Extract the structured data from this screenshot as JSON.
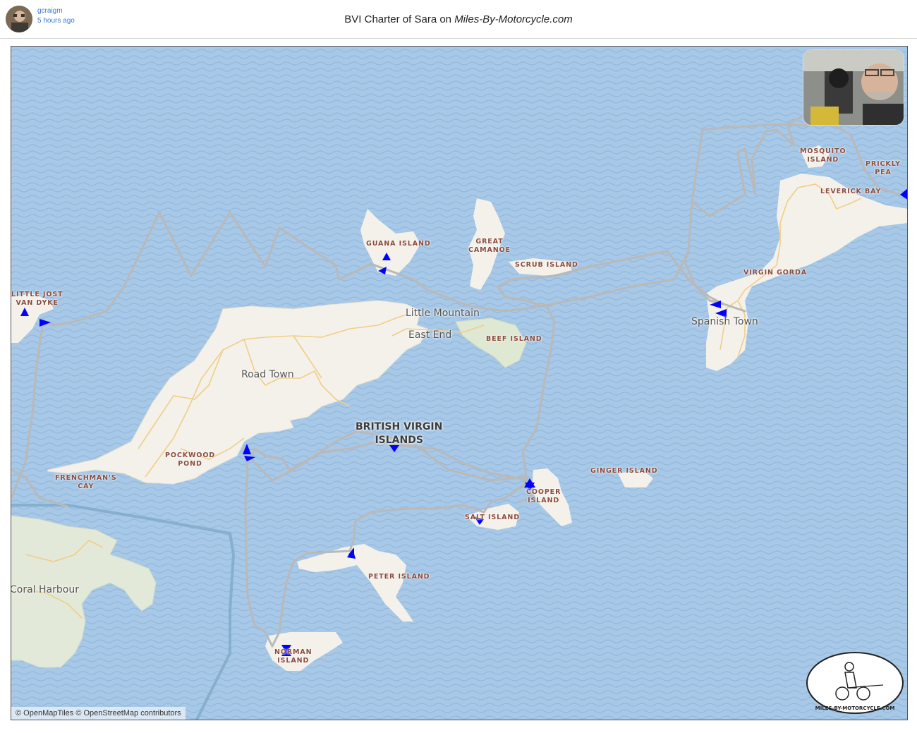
{
  "header": {
    "user": "gcraigm",
    "time_ago": "5 hours ago",
    "title_prefix": "BVI Charter of Sara on ",
    "title_site": "Miles-By-Motorcycle.com"
  },
  "map": {
    "water_color": "#a7c8e6",
    "land_color": "#f4f1ea",
    "road_color": "#f5d79e",
    "track_color": "#b9b9b9",
    "marker_color": "#0000ff",
    "island_labels": [
      {
        "id": "little-jost-van-dyke",
        "text": "LITTLE JOST\nVAN DYKE"
      },
      {
        "id": "guana-island",
        "text": "GUANA ISLAND"
      },
      {
        "id": "great-camanoe",
        "text": "GREAT\nCAMANOE"
      },
      {
        "id": "scrub-island",
        "text": "SCRUB ISLAND"
      },
      {
        "id": "beef-island",
        "text": "BEEF ISLAND"
      },
      {
        "id": "mosquito-island",
        "text": "MOSQUITO\nISLAND"
      },
      {
        "id": "prickly-pear",
        "text": "PRICKLY PEA"
      },
      {
        "id": "leverick-bay",
        "text": "LEVERICK BAY"
      },
      {
        "id": "virgin-gorda",
        "text": "VIRGIN GORDA"
      },
      {
        "id": "pockwood-pond",
        "text": "POCKWOOD\nPOND"
      },
      {
        "id": "frenchmans-cay",
        "text": "FRENCHMAN'S\nCAY"
      },
      {
        "id": "cooper-island",
        "text": "COOPER\nISLAND"
      },
      {
        "id": "ginger-island",
        "text": "GINGER ISLAND"
      },
      {
        "id": "salt-island",
        "text": "SALT ISLAND"
      },
      {
        "id": "peter-island",
        "text": "PETER ISLAND"
      },
      {
        "id": "norman-island",
        "text": "NORMAN\nISLAND"
      }
    ],
    "place_labels": [
      {
        "id": "little-mountain",
        "text": "Little Mountain"
      },
      {
        "id": "east-end",
        "text": "East End"
      },
      {
        "id": "road-town",
        "text": "Road Town"
      },
      {
        "id": "spanish-town",
        "text": "Spanish Town"
      },
      {
        "id": "coral-harbour",
        "text": "Coral Harbour"
      }
    ],
    "country_label": "BRITISH VIRGIN\nISLANDS",
    "attribution": "© OpenMapTiles © OpenStreetMap contributors",
    "logo_text": "MILES-BY-MOTORCYCLE.COM"
  }
}
